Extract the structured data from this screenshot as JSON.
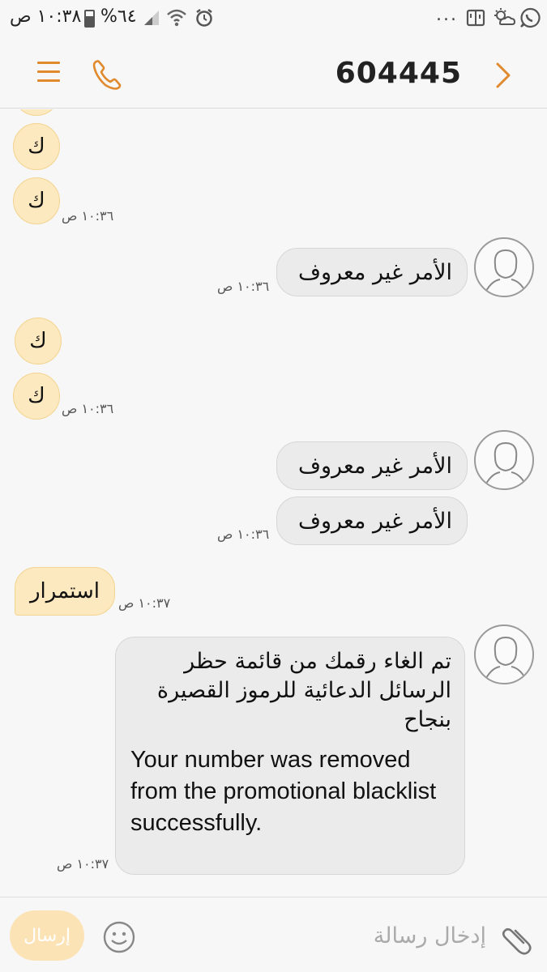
{
  "status_bar": {
    "time": "١٠:٣٨ ص",
    "battery": "%٦٤",
    "icons_left": [
      "signal-icon",
      "wifi-icon",
      "alarm-icon"
    ],
    "icons_right": [
      "more-notifications-icon",
      "bible-app-icon",
      "weather-icon",
      "whatsapp-icon"
    ],
    "more": "..."
  },
  "header": {
    "title": "604445",
    "accent_color": "#e08a2d"
  },
  "messages": [
    {
      "dir": "in",
      "text": "ك",
      "partial": true
    },
    {
      "dir": "in",
      "text": "ك"
    },
    {
      "dir": "in",
      "text": "ك",
      "time": "١٠:٣٦ ص"
    },
    {
      "dir": "out",
      "text": "الأمر غير معروف",
      "time": "١٠:٣٦ ص"
    },
    {
      "dir": "in",
      "text": "ك"
    },
    {
      "dir": "in",
      "text": "ك",
      "time": "١٠:٣٦ ص"
    },
    {
      "dir": "out",
      "text": "الأمر غير معروف"
    },
    {
      "dir": "out",
      "text": "الأمر غير معروف",
      "time": "١٠:٣٦ ص"
    },
    {
      "dir": "in",
      "text": "استمرار",
      "time": "١٠:٣٧ ص"
    },
    {
      "dir": "out",
      "text_ar": "تم الغاء رقمك من قائمة حظر الرسائل الدعائية للرموز القصيرة بنجاح",
      "text_en": "Your number was removed from the promotional blacklist successfully.",
      "time": "١٠:٣٧ ص"
    }
  ],
  "composer": {
    "placeholder": "إدخال رسالة",
    "send_label": "إرسال"
  }
}
